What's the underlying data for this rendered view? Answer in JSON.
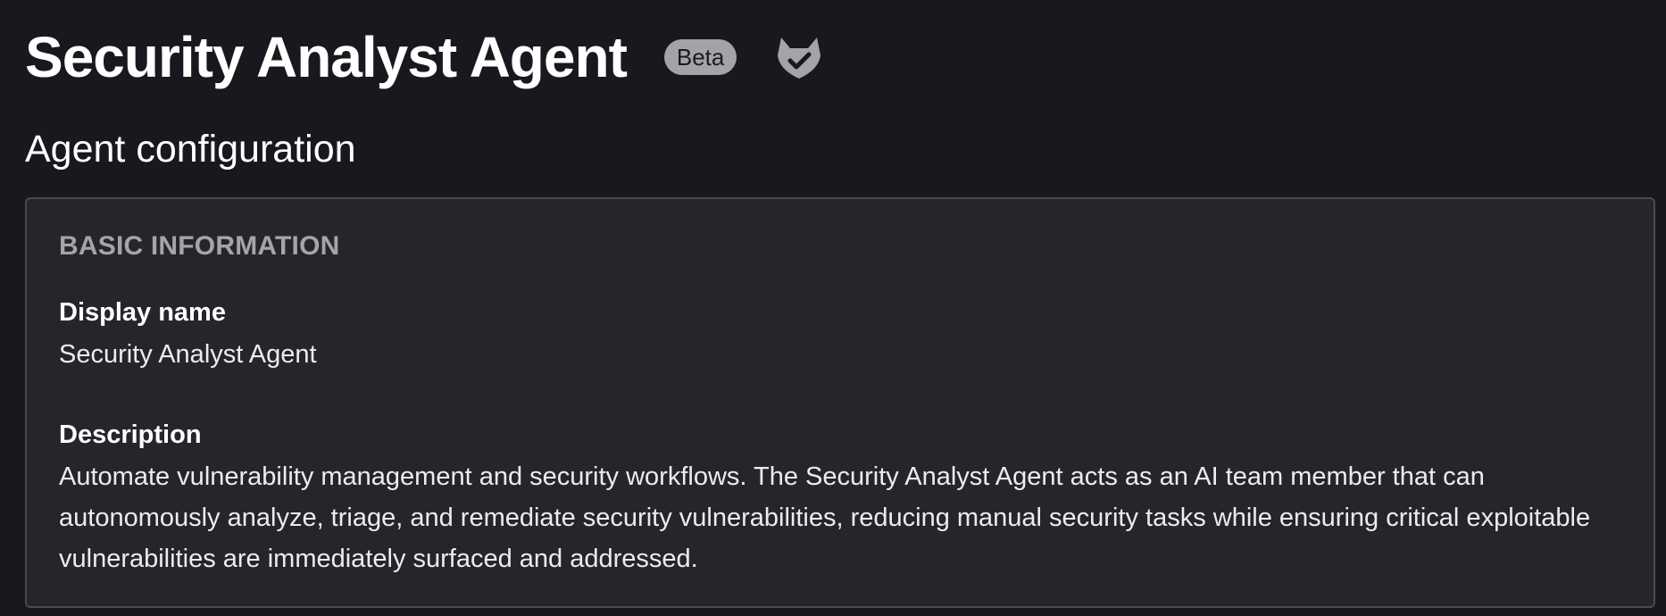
{
  "header": {
    "title": "Security Analyst Agent",
    "badge": "Beta",
    "logo_icon": "gitlab-verified-icon"
  },
  "subtitle": "Agent configuration",
  "card": {
    "section_heading": "BASIC INFORMATION",
    "fields": [
      {
        "label": "Display name",
        "value": "Security Analyst Agent"
      },
      {
        "label": "Description",
        "value": "Automate vulnerability management and security workflows. The Security Analyst Agent acts as an AI team member that can autonomously analyze, triage, and remediate security vulnerabilities, reducing manual security tasks while ensuring critical exploitable vulnerabilities are immediately surfaced and addressed."
      }
    ]
  },
  "colors": {
    "background": "#19181e",
    "card_background": "#26252b",
    "card_border": "#4a4950",
    "badge_background": "#a4a3a8",
    "muted_heading": "#a5a4ab"
  }
}
